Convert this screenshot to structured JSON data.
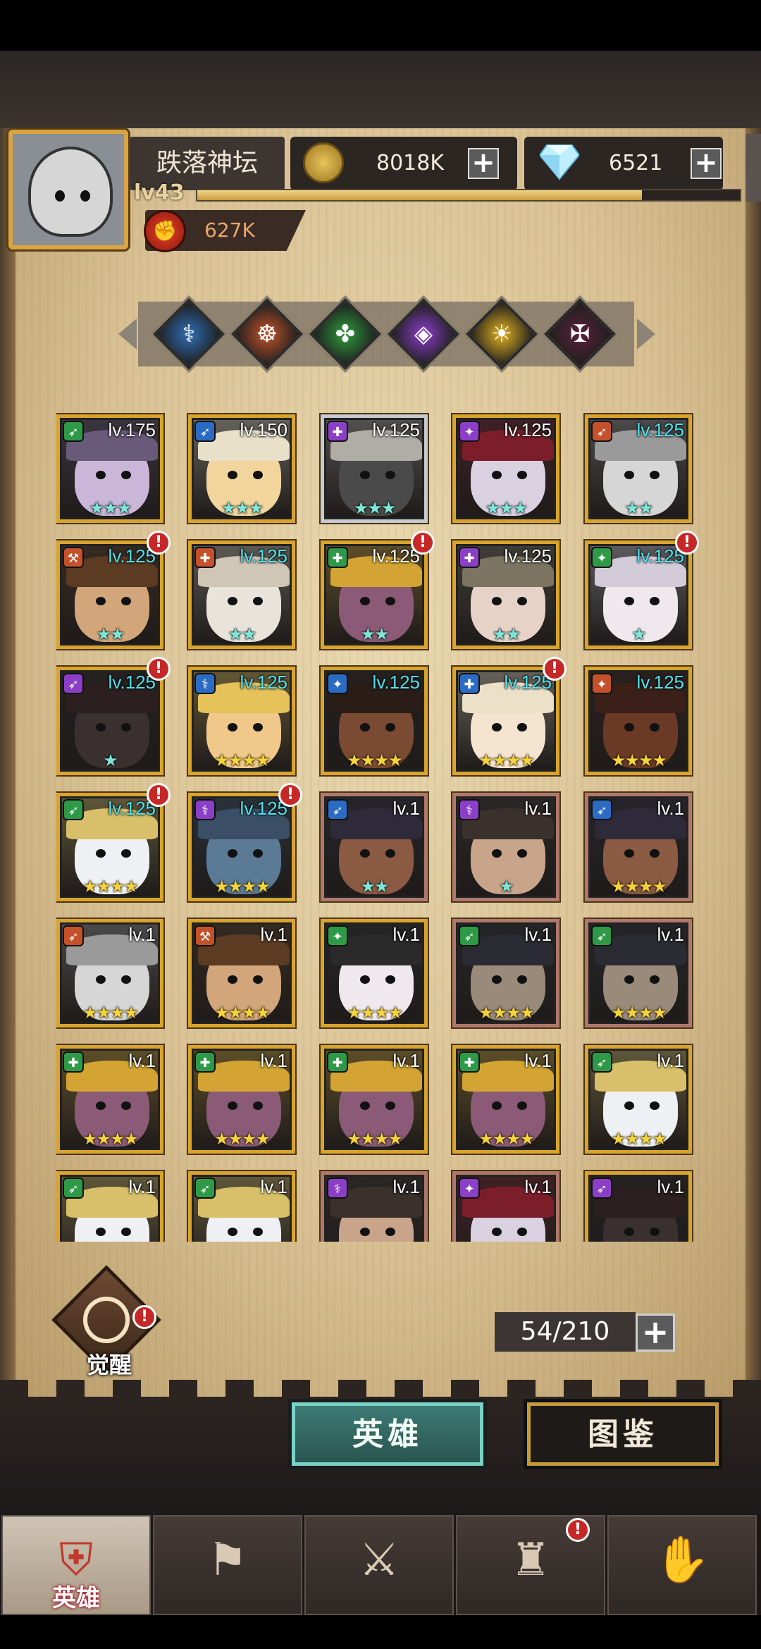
{
  "header": {
    "player_name": "跌落神坛",
    "level": "lv43",
    "xp_progress": 0.82,
    "gold": "8018K",
    "diamonds": "6521",
    "power": "627K",
    "plus_symbol": "+"
  },
  "factions": [
    {
      "name": "blue-faction-icon",
      "glyph": "⚕",
      "color": "#2f6fb5"
    },
    {
      "name": "orange-faction-icon",
      "glyph": "☸",
      "color": "#c3542a"
    },
    {
      "name": "green-faction-icon",
      "glyph": "✤",
      "color": "#2f9b3e"
    },
    {
      "name": "purple-faction-icon",
      "glyph": "◈",
      "color": "#8a3ec9"
    },
    {
      "name": "yellow-faction-icon",
      "glyph": "☀",
      "color": "#e3b221"
    },
    {
      "name": "dark-faction-icon",
      "glyph": "✠",
      "color": "#5a2238"
    }
  ],
  "heroes": [
    {
      "level": "lv.175",
      "cyan": false,
      "stars": "★★★",
      "star_color": "#7ee6d8",
      "cls_color": "#2e9a47",
      "cls_icon": "➶",
      "skin": "#c9b6d8",
      "hat": "#6a5a7a",
      "frame": "gold",
      "alert": false
    },
    {
      "level": "lv.150",
      "cyan": false,
      "stars": "★★★",
      "star_color": "#7ee6d8",
      "cls_color": "#2c6bc4",
      "cls_icon": "➶",
      "skin": "#f2d59d",
      "hat": "#e8e0c8",
      "frame": "gold",
      "alert": false
    },
    {
      "level": "lv.125",
      "cyan": false,
      "stars": "★★★",
      "star_color": "#7ee6d8",
      "cls_color": "#8b3fc6",
      "cls_icon": "✚",
      "skin": "#4a4a4a",
      "hat": "#b0aca6",
      "frame": "grey",
      "alert": false
    },
    {
      "level": "lv.125",
      "cyan": false,
      "stars": "★★★",
      "star_color": "#7ee6d8",
      "cls_color": "#8b3fc6",
      "cls_icon": "✦",
      "skin": "#d9d0e0",
      "hat": "#7c1e2a",
      "frame": "gold",
      "alert": false
    },
    {
      "level": "lv.125",
      "cyan": true,
      "stars": "★★",
      "star_color": "#7ee6d8",
      "cls_color": "#c4512a",
      "cls_icon": "➶",
      "skin": "#d6d6d6",
      "hat": "#9a9a9a",
      "frame": "gold",
      "alert": false
    },
    {
      "level": "lv.125",
      "cyan": true,
      "stars": "★★",
      "star_color": "#7ee6d8",
      "cls_color": "#c4512a",
      "cls_icon": "⚒",
      "skin": "#d2a57a",
      "hat": "#5b3b22",
      "frame": "gold",
      "alert": true
    },
    {
      "level": "lv.125",
      "cyan": true,
      "stars": "★★",
      "star_color": "#7ee6d8",
      "cls_color": "#c4512a",
      "cls_icon": "✚",
      "skin": "#e8e4dc",
      "hat": "#cfc6b6",
      "frame": "gold",
      "alert": false
    },
    {
      "level": "lv.125",
      "cyan": false,
      "stars": "★★",
      "star_color": "#7ee6d8",
      "cls_color": "#2e9a47",
      "cls_icon": "✚",
      "skin": "#8a5a76",
      "hat": "#d3a434",
      "frame": "gold",
      "alert": true
    },
    {
      "level": "lv.125",
      "cyan": false,
      "stars": "★★",
      "star_color": "#7ee6d8",
      "cls_color": "#8b3fc6",
      "cls_icon": "✚",
      "skin": "#e6d2c6",
      "hat": "#7a7460",
      "frame": "gold",
      "alert": false
    },
    {
      "level": "lv.125",
      "cyan": true,
      "stars": "★",
      "star_color": "#7ee6d8",
      "cls_color": "#2e9a47",
      "cls_icon": "✦",
      "skin": "#efe9ee",
      "hat": "#d4cbd8",
      "frame": "gold",
      "alert": true
    },
    {
      "level": "lv.125",
      "cyan": true,
      "stars": "★",
      "star_color": "#7ee6d8",
      "cls_color": "#8b3fc6",
      "cls_icon": "➶",
      "skin": "#3b3030",
      "hat": "#2b1f1f",
      "frame": "gold",
      "alert": true
    },
    {
      "level": "lv.125",
      "cyan": true,
      "stars": "★★★★",
      "star_color": "#f5d33a",
      "cls_color": "#2c6bc4",
      "cls_icon": "⚕",
      "skin": "#f0c98a",
      "hat": "#e6c25a",
      "frame": "gold",
      "alert": false
    },
    {
      "level": "lv.125",
      "cyan": true,
      "stars": "★★★★",
      "star_color": "#f5d33a",
      "cls_color": "#2c6bc4",
      "cls_icon": "✦",
      "skin": "#7a4a32",
      "hat": "#2a1c16",
      "frame": "gold",
      "alert": false
    },
    {
      "level": "lv.125",
      "cyan": true,
      "stars": "★★★★",
      "star_color": "#f5d33a",
      "cls_color": "#2c6bc4",
      "cls_icon": "✚",
      "skin": "#f4e4d0",
      "hat": "#ece0c8",
      "frame": "gold",
      "alert": true
    },
    {
      "level": "lv.125",
      "cyan": true,
      "stars": "★★★★",
      "star_color": "#f5d33a",
      "cls_color": "#c4512a",
      "cls_icon": "✦",
      "skin": "#6a3a26",
      "hat": "#3a2018",
      "frame": "gold",
      "alert": false
    },
    {
      "level": "lv.125",
      "cyan": true,
      "stars": "★★★★",
      "star_color": "#f5d33a",
      "cls_color": "#2e9a47",
      "cls_icon": "➶",
      "skin": "#eef0f4",
      "hat": "#d8c06a",
      "frame": "gold",
      "alert": true
    },
    {
      "level": "lv.125",
      "cyan": true,
      "stars": "★★★★",
      "star_color": "#f5d33a",
      "cls_color": "#8b3fc6",
      "cls_icon": "⚕",
      "skin": "#5a7a96",
      "hat": "#3a4f66",
      "frame": "gold",
      "alert": true
    },
    {
      "level": "lv.1",
      "cyan": false,
      "stars": "★★",
      "star_color": "#7ee6d8",
      "cls_color": "#2c6bc4",
      "cls_icon": "➶",
      "skin": "#8a5a42",
      "hat": "#2e2a3a",
      "frame": "brown",
      "alert": false
    },
    {
      "level": "lv.1",
      "cyan": false,
      "stars": "★",
      "star_color": "#7ee6d8",
      "cls_color": "#8b3fc6",
      "cls_icon": "⚕",
      "skin": "#c8a48a",
      "hat": "#3a302c",
      "frame": "brown",
      "alert": false
    },
    {
      "level": "lv.1",
      "cyan": false,
      "stars": "★★★★",
      "star_color": "#f5d33a",
      "cls_color": "#2c6bc4",
      "cls_icon": "➶",
      "skin": "#8a5a42",
      "hat": "#2e2a3a",
      "frame": "brown",
      "alert": false
    },
    {
      "level": "lv.1",
      "cyan": false,
      "stars": "★★★★",
      "star_color": "#f5d33a",
      "cls_color": "#c4512a",
      "cls_icon": "➶",
      "skin": "#d6d6d6",
      "hat": "#9a9a9a",
      "frame": "gold",
      "alert": false
    },
    {
      "level": "lv.1",
      "cyan": false,
      "stars": "★★★★",
      "star_color": "#f5d33a",
      "cls_color": "#c4512a",
      "cls_icon": "⚒",
      "skin": "#d2a57a",
      "hat": "#5b3b22",
      "frame": "gold",
      "alert": false
    },
    {
      "level": "lv.1",
      "cyan": false,
      "stars": "★★★★",
      "star_color": "#f5d33a",
      "cls_color": "#2e9a47",
      "cls_icon": "✦",
      "skin": "#efe9ee",
      "hat": "#2a2a2a",
      "frame": "gold",
      "alert": false
    },
    {
      "level": "lv.1",
      "cyan": false,
      "stars": "★★★★",
      "star_color": "#f5d33a",
      "cls_color": "#2e9a47",
      "cls_icon": "➶",
      "skin": "#9a8a7a",
      "hat": "#2b2b33",
      "frame": "brown",
      "alert": false
    },
    {
      "level": "lv.1",
      "cyan": false,
      "stars": "★★★★",
      "star_color": "#f5d33a",
      "cls_color": "#2e9a47",
      "cls_icon": "➶",
      "skin": "#9a8a7a",
      "hat": "#2b2b33",
      "frame": "brown",
      "alert": false
    },
    {
      "level": "lv.1",
      "cyan": false,
      "stars": "★★★★",
      "star_color": "#f5d33a",
      "cls_color": "#2e9a47",
      "cls_icon": "✚",
      "skin": "#8a5a76",
      "hat": "#d3a434",
      "frame": "gold",
      "alert": false
    },
    {
      "level": "lv.1",
      "cyan": false,
      "stars": "★★★★",
      "star_color": "#f5d33a",
      "cls_color": "#2e9a47",
      "cls_icon": "✚",
      "skin": "#8a5a76",
      "hat": "#d3a434",
      "frame": "gold",
      "alert": false
    },
    {
      "level": "lv.1",
      "cyan": false,
      "stars": "★★★★",
      "star_color": "#f5d33a",
      "cls_color": "#2e9a47",
      "cls_icon": "✚",
      "skin": "#8a5a76",
      "hat": "#d3a434",
      "frame": "gold",
      "alert": false
    },
    {
      "level": "lv.1",
      "cyan": false,
      "stars": "★★★★",
      "star_color": "#f5d33a",
      "cls_color": "#2e9a47",
      "cls_icon": "✚",
      "skin": "#8a5a76",
      "hat": "#d3a434",
      "frame": "gold",
      "alert": false
    },
    {
      "level": "lv.1",
      "cyan": false,
      "stars": "★★★★",
      "star_color": "#f5d33a",
      "cls_color": "#2e9a47",
      "cls_icon": "➶",
      "skin": "#eef0f4",
      "hat": "#d8c06a",
      "frame": "gold",
      "alert": false
    },
    {
      "level": "lv.1",
      "cyan": false,
      "stars": "",
      "star_color": "#f5d33a",
      "cls_color": "#2e9a47",
      "cls_icon": "➶",
      "skin": "#eef0f4",
      "hat": "#d8c06a",
      "frame": "gold",
      "alert": false
    },
    {
      "level": "lv.1",
      "cyan": false,
      "stars": "",
      "star_color": "#f5d33a",
      "cls_color": "#2e9a47",
      "cls_icon": "➶",
      "skin": "#eef0f4",
      "hat": "#d8c06a",
      "frame": "gold",
      "alert": false
    },
    {
      "level": "lv.1",
      "cyan": false,
      "stars": "",
      "star_color": "#f5d33a",
      "cls_color": "#8b3fc6",
      "cls_icon": "⚕",
      "skin": "#c8a48a",
      "hat": "#3a302c",
      "frame": "brown",
      "alert": false
    },
    {
      "level": "lv.1",
      "cyan": false,
      "stars": "",
      "star_color": "#f5d33a",
      "cls_color": "#8b3fc6",
      "cls_icon": "✦",
      "skin": "#d9d0e0",
      "hat": "#7c1e2a",
      "frame": "brown",
      "alert": false
    },
    {
      "level": "lv.1",
      "cyan": false,
      "stars": "",
      "star_color": "#f5d33a",
      "cls_color": "#8b3fc6",
      "cls_icon": "➶",
      "skin": "#3b3030",
      "hat": "#2b1f1f",
      "frame": "gold",
      "alert": false
    }
  ],
  "alert_symbol": "!",
  "awaken": {
    "label": "觉醒"
  },
  "capacity": {
    "text": "54/210"
  },
  "sub_tabs": {
    "heroes": "英雄",
    "codex": "图鉴"
  },
  "nav": [
    {
      "name": "nav-heroes",
      "label": "英雄",
      "active": true,
      "alert": false
    },
    {
      "name": "nav-expedition",
      "label": "",
      "active": false,
      "alert": false
    },
    {
      "name": "nav-battle",
      "label": "",
      "active": false,
      "alert": false
    },
    {
      "name": "nav-castle",
      "label": "",
      "active": false,
      "alert": true
    },
    {
      "name": "nav-guild",
      "label": "",
      "active": false,
      "alert": false
    }
  ]
}
